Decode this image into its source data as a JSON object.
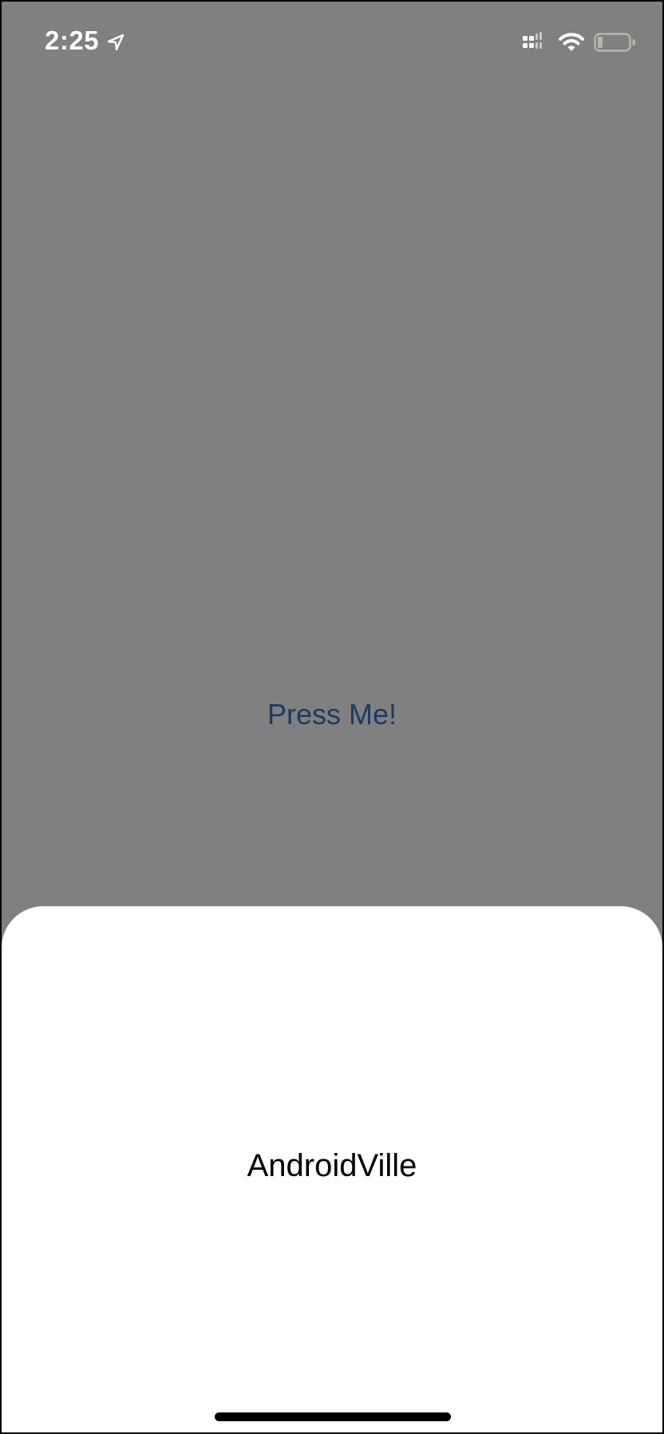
{
  "status_bar": {
    "time": "2:25",
    "icons": [
      "location-arrow-icon",
      "cellular-signal-icon",
      "wifi-icon",
      "battery-icon"
    ]
  },
  "main": {
    "button_label": "Press Me!",
    "background_color": "#808080",
    "button_color": "#1d3b63"
  },
  "bottom_sheet": {
    "title": "AndroidVille",
    "background_color": "#ffffff"
  }
}
